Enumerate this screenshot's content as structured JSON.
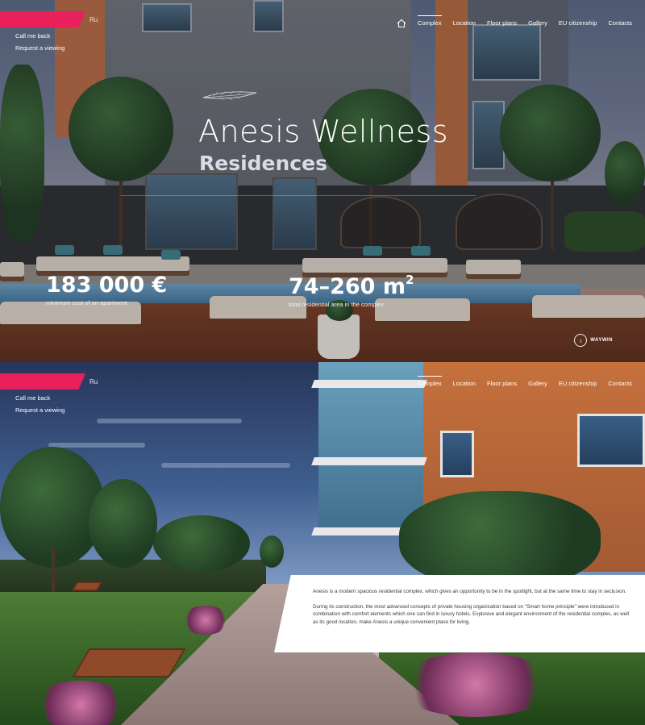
{
  "language_switch": "Ru",
  "side_links": {
    "call_me_back": "Call me back",
    "request_viewing": "Request a viewing"
  },
  "nav": {
    "home_icon": "home-icon",
    "items": [
      "Complex",
      "Location",
      "Floor plans",
      "Gallery",
      "EU citizenship",
      "Contacts"
    ],
    "active": "Complex"
  },
  "hero": {
    "title": "Anesis Wellness",
    "subtitle": "Residences",
    "stats": [
      {
        "value": "183 000 €",
        "label": "minimum cost of an apartment"
      },
      {
        "value": "74–260 m",
        "superscript": "2",
        "label": "total residential area in the complex"
      }
    ],
    "watermark": "WAYWIN"
  },
  "about": {
    "paragraph_1": "Anesis is a modern spacious residential complex, which gives an opportunity to be in the spotlight, but at the same time to stay in seclusion.",
    "paragraph_2": "During its construction, the most advanced concepts of private housing organization based on \"Smart home principle\" were introduced in combination with comfort elements which one can find in luxury hotels. Explosive and elegant environment of the residential complex, as well as its good location, make Anesis a unique convenient place for living."
  },
  "colors": {
    "brand_accent": "#e8205c",
    "text_light": "#ffffff",
    "card_bg": "#ffffff"
  }
}
